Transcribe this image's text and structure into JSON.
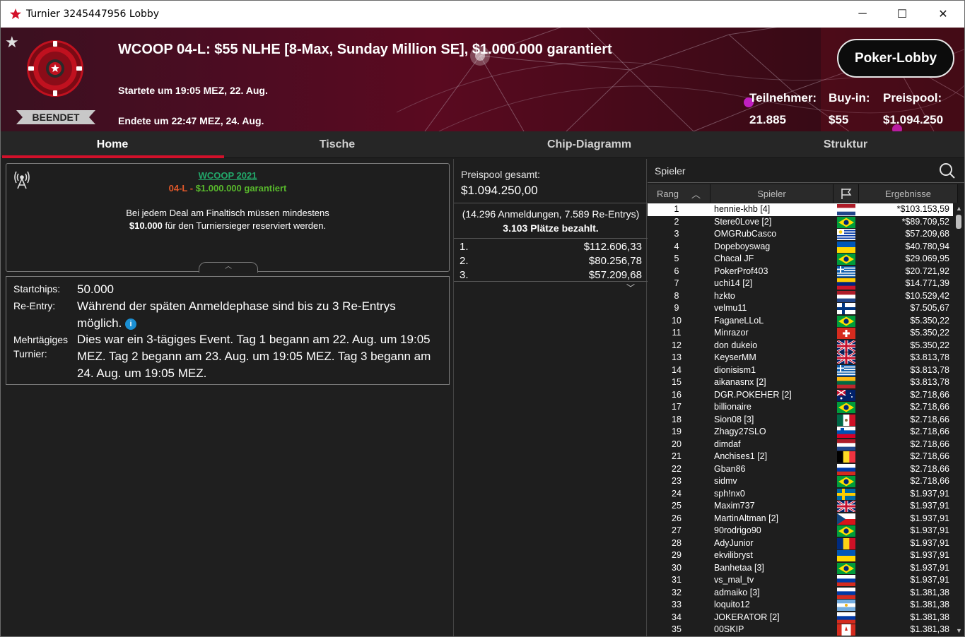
{
  "window": {
    "title": "Turnier 3245447956 Lobby",
    "minimize": "─",
    "maximize": "☐",
    "close": "✕"
  },
  "header": {
    "tournament_name": "WCOOP 04-L: $55 NLHE [8-Max, Sunday Million SE], $1.000.000 garantiert",
    "started": "Startete um 19:05 MEZ, 22. Aug.",
    "ended": "Endete um 22:47 MEZ, 24. Aug.",
    "status": "BEENDET",
    "lobby_button": "Poker-Lobby",
    "players_label": "Teilnehmer:",
    "players_value": "21.885",
    "buyin_label": "Buy-in:",
    "buyin_value": "$55",
    "prizepool_label": "Preispool:",
    "prizepool_value": "$1.094.250",
    "accent_color": "#d3102a"
  },
  "tabs": [
    {
      "label": "Home",
      "active": true
    },
    {
      "label": "Tische",
      "active": false
    },
    {
      "label": "Chip-Diagramm",
      "active": false
    },
    {
      "label": "Struktur",
      "active": false
    }
  ],
  "info": {
    "series_link": "WCOOP 2021",
    "event_code": "04-L",
    "event_sep": " - ",
    "event_guarantee": "$1.000.000 garantiert",
    "deal_text_1": "Bei jedem Deal am Finaltisch müssen mindestens",
    "deal_amount": "$10.000",
    "deal_text_2": " für den Turniersieger reserviert werden."
  },
  "details": {
    "startchips_label": "Startchips:",
    "startchips_value": "50.000",
    "reentry_label": "Re-Entry:",
    "reentry_value": "Während der späten Anmeldephase sind bis zu 3 Re-Entrys möglich.",
    "multiday_label_1": "Mehrtägiges",
    "multiday_label_2": "Turnier:",
    "multiday_value": "Dies war ein 3-tägiges Event. Tag 1 begann am 22. Aug. um 19:05 MEZ. Tag 2 begann am 23. Aug. um 19:05 MEZ. Tag 3 begann am 24. Aug. um 19:05 MEZ."
  },
  "prizes": {
    "label": "Preispool gesamt:",
    "total": "$1.094.250,00",
    "entries": "(14.296 Anmeldungen, 7.589 Re-Entrys)",
    "paid": "3.103 Plätze bezahlt.",
    "places": [
      {
        "pos": "1.",
        "amount": "$112.606,33"
      },
      {
        "pos": "2.",
        "amount": "$80.256,78"
      },
      {
        "pos": "3.",
        "amount": "$57.209,68"
      }
    ]
  },
  "players": {
    "title": "Spieler",
    "columns": {
      "rank": "Rang",
      "player": "Spieler",
      "results": "Ergebnisse"
    },
    "rows": [
      {
        "rank": "1",
        "name": "hennie-khb [4]",
        "flag": "nl",
        "payout": "*$103.153,59"
      },
      {
        "rank": "2",
        "name": "Stere0Love [2]",
        "flag": "br",
        "payout": "*$89.709,52"
      },
      {
        "rank": "3",
        "name": "OMGRubCasco",
        "flag": "uy",
        "payout": "$57.209,68"
      },
      {
        "rank": "4",
        "name": "Dopeboyswag",
        "flag": "ua",
        "payout": "$40.780,94"
      },
      {
        "rank": "5",
        "name": "Chacal JF",
        "flag": "br",
        "payout": "$29.069,95"
      },
      {
        "rank": "6",
        "name": "PokerProf403",
        "flag": "gr",
        "payout": "$20.721,92"
      },
      {
        "rank": "7",
        "name": "uchi14 [2]",
        "flag": "ve",
        "payout": "$14.771,39"
      },
      {
        "rank": "8",
        "name": "hzkto",
        "flag": "nl",
        "payout": "$10.529,42"
      },
      {
        "rank": "9",
        "name": "velmu11",
        "flag": "fi",
        "payout": "$7.505,67"
      },
      {
        "rank": "10",
        "name": "FaganeLLoL",
        "flag": "br",
        "payout": "$5.350,22"
      },
      {
        "rank": "11",
        "name": "Minrazor",
        "flag": "ch",
        "payout": "$5.350,22"
      },
      {
        "rank": "12",
        "name": "don dukeio",
        "flag": "gb",
        "payout": "$5.350,22"
      },
      {
        "rank": "13",
        "name": "KeyserMM",
        "flag": "gb",
        "payout": "$3.813,78"
      },
      {
        "rank": "14",
        "name": "dionisism1",
        "flag": "gr",
        "payout": "$3.813,78"
      },
      {
        "rank": "15",
        "name": "aikanasnx [2]",
        "flag": "lt",
        "payout": "$3.813,78"
      },
      {
        "rank": "16",
        "name": "DGR.POKEHER [2]",
        "flag": "au",
        "payout": "$2.718,66"
      },
      {
        "rank": "17",
        "name": "billionaire",
        "flag": "br",
        "payout": "$2.718,66"
      },
      {
        "rank": "18",
        "name": "Sion08 [3]",
        "flag": "mx",
        "payout": "$2.718,66"
      },
      {
        "rank": "19",
        "name": "Zhagy27SLO",
        "flag": "si",
        "payout": "$2.718,66"
      },
      {
        "rank": "20",
        "name": "dimdaf",
        "flag": "nl",
        "payout": "$2.718,66"
      },
      {
        "rank": "21",
        "name": "Anchises1 [2]",
        "flag": "be",
        "payout": "$2.718,66"
      },
      {
        "rank": "22",
        "name": "Gban86",
        "flag": "ru",
        "payout": "$2.718,66"
      },
      {
        "rank": "23",
        "name": "sidmv",
        "flag": "br",
        "payout": "$2.718,66"
      },
      {
        "rank": "24",
        "name": "sph!nx0",
        "flag": "se",
        "payout": "$1.937,91"
      },
      {
        "rank": "25",
        "name": "Maxim737",
        "flag": "gb",
        "payout": "$1.937,91"
      },
      {
        "rank": "26",
        "name": "MartinAltman [2]",
        "flag": "cz",
        "payout": "$1.937,91"
      },
      {
        "rank": "27",
        "name": "90rodrigo90",
        "flag": "br",
        "payout": "$1.937,91"
      },
      {
        "rank": "28",
        "name": "AdyJunior",
        "flag": "ro",
        "payout": "$1.937,91"
      },
      {
        "rank": "29",
        "name": "ekvilibryst",
        "flag": "ua",
        "payout": "$1.937,91"
      },
      {
        "rank": "30",
        "name": "Banhetaa [3]",
        "flag": "br",
        "payout": "$1.937,91"
      },
      {
        "rank": "31",
        "name": "vs_mal_tv",
        "flag": "ru",
        "payout": "$1.937,91"
      },
      {
        "rank": "32",
        "name": "admaiko [3]",
        "flag": "ru",
        "payout": "$1.381,38"
      },
      {
        "rank": "33",
        "name": "loquito12",
        "flag": "ar",
        "payout": "$1.381,38"
      },
      {
        "rank": "34",
        "name": "JOKERATOR [2]",
        "flag": "ru",
        "payout": "$1.381,38"
      },
      {
        "rank": "35",
        "name": "00SKIP",
        "flag": "ca",
        "payout": "$1.381,38"
      }
    ]
  }
}
